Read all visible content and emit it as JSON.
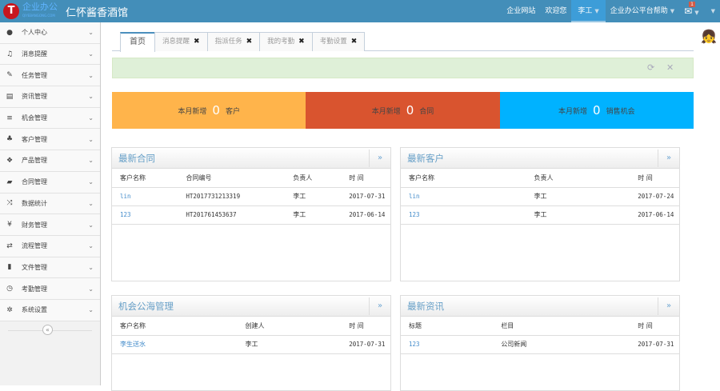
{
  "header": {
    "logo_letter": "T",
    "logo_text": "企业办公",
    "logo_sub": "QIYEBANGONG.COM",
    "title": "仁怀酱香酒馆",
    "nav": {
      "site": "企业网站",
      "welcome": "欢迎您",
      "user": "李工",
      "help": "企业办公平台帮助",
      "mail_badge": "1"
    }
  },
  "sidebar": {
    "items": [
      {
        "label": "个人中心",
        "icon": "user-icon"
      },
      {
        "label": "消息提醒",
        "icon": "bell-icon"
      },
      {
        "label": "任务管理",
        "icon": "edit-icon"
      },
      {
        "label": "资讯管理",
        "icon": "file-text-icon"
      },
      {
        "label": "机会管理",
        "icon": "list-icon"
      },
      {
        "label": "客户管理",
        "icon": "group-icon"
      },
      {
        "label": "产品管理",
        "icon": "dropbox-icon"
      },
      {
        "label": "合同管理",
        "icon": "folder-open-icon"
      },
      {
        "label": "数据统计",
        "icon": "random-icon"
      },
      {
        "label": "财务管理",
        "icon": "yen-icon"
      },
      {
        "label": "流程管理",
        "icon": "retweet-icon"
      },
      {
        "label": "文件管理",
        "icon": "file-icon"
      },
      {
        "label": "考勤管理",
        "icon": "clock-icon"
      },
      {
        "label": "系统设置",
        "icon": "cog-icon"
      }
    ],
    "collapse": "«"
  },
  "tabs": [
    {
      "label": "首页"
    },
    {
      "label": "消息提醒"
    },
    {
      "label": "指派任务"
    },
    {
      "label": "我的考勤"
    },
    {
      "label": "考勤设置"
    }
  ],
  "stats": [
    {
      "prefix": "本月新增",
      "value": "0",
      "suffix": "客户",
      "color": "#ffb44b"
    },
    {
      "prefix": "本月新增",
      "value": "0",
      "suffix": "合同",
      "color": "#d9542f"
    },
    {
      "prefix": "本月新增",
      "value": "0",
      "suffix": "销售机会",
      "color": "#00b2ff"
    }
  ],
  "panels": {
    "contracts": {
      "title": "最新合同",
      "headers": [
        "客户名称",
        "合同编号",
        "负责人",
        "时 间"
      ],
      "rows": [
        [
          "lin",
          "HT2017731213319",
          "李工",
          "2017-07-31"
        ],
        [
          "123",
          "HT201761453637",
          "李工",
          "2017-06-14"
        ]
      ]
    },
    "customers": {
      "title": "最新客户",
      "headers": [
        "客户名称",
        "负责人",
        "时 间"
      ],
      "rows": [
        [
          "lin",
          "李工",
          "2017-07-24"
        ],
        [
          "123",
          "李工",
          "2017-06-14"
        ]
      ]
    },
    "opportunities": {
      "title": "机会公海管理",
      "headers": [
        "客户名称",
        "创建人",
        "时 间"
      ],
      "rows": [
        [
          "李生送水",
          "李工",
          "2017-07-31"
        ]
      ]
    },
    "news": {
      "title": "最新资讯",
      "headers": [
        "标题",
        "栏目",
        "时 间"
      ],
      "rows": [
        [
          "123",
          "公司新闻",
          "2017-07-31"
        ]
      ]
    },
    "more": "»"
  }
}
